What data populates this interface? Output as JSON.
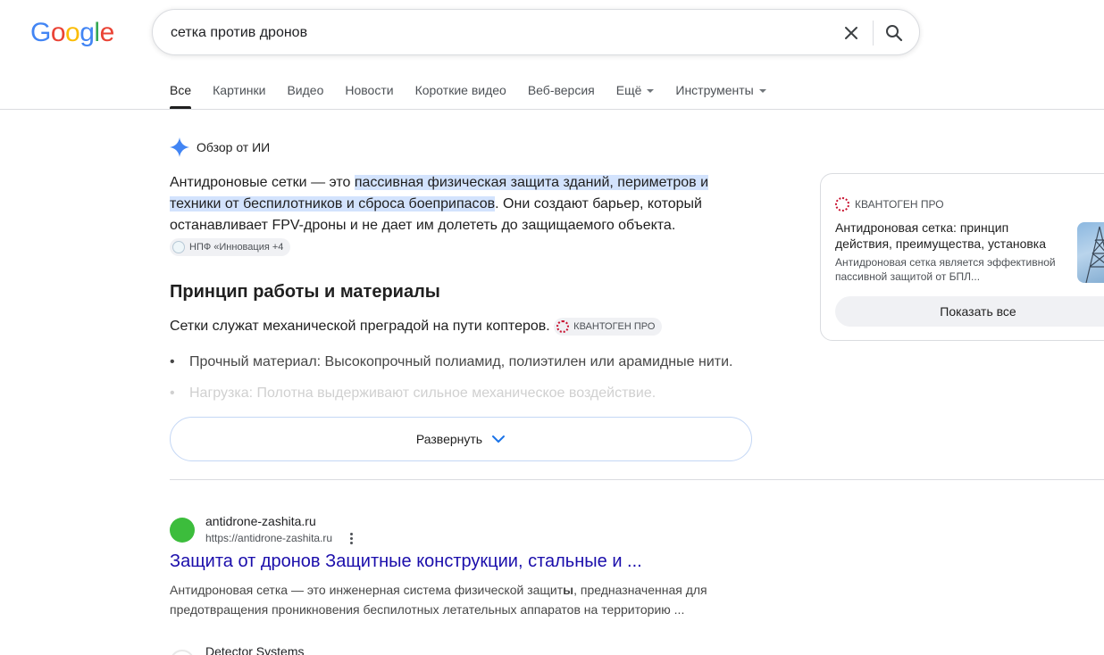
{
  "logo": {
    "letters": [
      "G",
      "o",
      "o",
      "g",
      "l",
      "e"
    ],
    "colors": [
      "#4285F4",
      "#EA4335",
      "#FBBC05",
      "#4285F4",
      "#34A853",
      "#EA4335"
    ]
  },
  "search": {
    "query": "сетка против дронов"
  },
  "tabs": [
    {
      "label": "Все",
      "active": true
    },
    {
      "label": "Картинки"
    },
    {
      "label": "Видео"
    },
    {
      "label": "Новости"
    },
    {
      "label": "Короткие видео"
    },
    {
      "label": "Веб-версия"
    },
    {
      "label": "Ещё"
    },
    {
      "label": "Инструменты"
    }
  ],
  "ai_overview": {
    "label": "Обзор от ИИ",
    "p1_start": "Антидроновые сетки — это ",
    "p1_highlight": "пассивная физическая защита зданий, периметров и техники от беспилотников и сброса боеприпасов",
    "p1_end": ". Они создают барьер, который останавливает FPV-дроны и не дает им долететь до защищаемого объекта.",
    "p1_chip": "НПФ «Инновация +4",
    "heading": "Принцип работы и материалы",
    "p2": "Сетки служат механической преградой на пути коптеров.",
    "p2_chip": "КВАНТОГЕН ПРО",
    "bullet1": "Прочный материал: Высокопрочный полиамид, полиэтилен или арамидные нити.",
    "bullet2": "Нагрузка: Полотна выдерживают сильное механическое воздействие.",
    "expand": "Развернуть"
  },
  "card": {
    "source": "КВАНТОГЕН ПРО",
    "title": "Антидроновая сетка: принцип действия, преимущества, установка",
    "desc": "Антидроновая сетка является эффективной пассивной защитой от БПЛ...",
    "show_all": "Показать все"
  },
  "results": [
    {
      "site": "antidrone-zashita.ru",
      "url": "https://antidrone-zashita.ru",
      "title": "Защита от дронов Защитные конструкции, стальные и ...",
      "snippet_a": "Антидроновая сетка — это инженерная система физической защит",
      "snippet_b": "ы",
      "snippet_c": ", предназначенная для предотвращения проникновения беспилотных летательных аппаратов на территорию ..."
    },
    {
      "site": "Detector Systems"
    }
  ]
}
